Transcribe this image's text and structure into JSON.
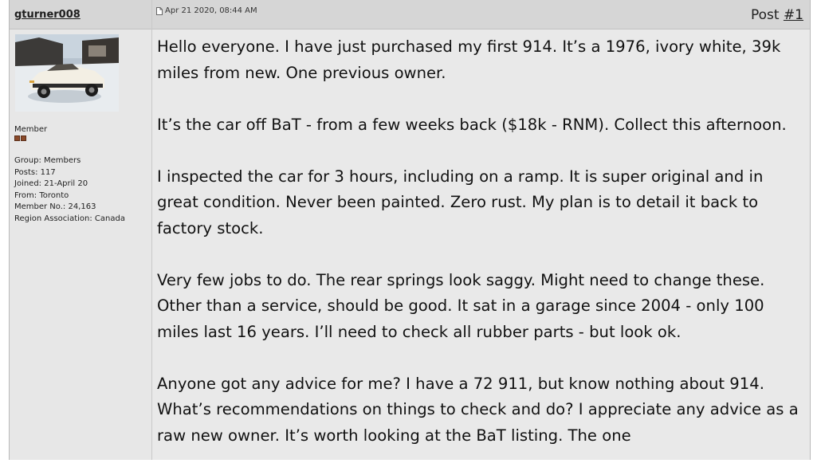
{
  "author": {
    "username": "gturner008",
    "member_title": "Member",
    "info": [
      "Group: Members",
      "Posts: 117",
      "Joined: 21-April 20",
      "From: Toronto",
      "Member No.: 24,163",
      "Region Association: Canada"
    ]
  },
  "post": {
    "date": "Apr 21 2020, 08:44 AM",
    "label": "Post",
    "number": "#1",
    "paragraphs": [
      "Hello everyone. I have just purchased my first 914. It’s a 1976, ivory white, 39k miles from new. One previous owner.",
      "It’s the car off BaT - from a few weeks back ($18k - RNM). Collect this afternoon.",
      "I inspected the car for 3 hours, including on a ramp. It is super original and in great condition. Never been painted. Zero rust. My plan is to detail it back to factory stock.",
      "Very few jobs to do. The rear springs look saggy. Might need to change these. Other than a service, should be good. It sat in a garage since 2004 - only 100 miles last 16 years. I’ll need to check all rubber parts - but look ok.",
      "Anyone got any advice for me? I have a 72 911, but know nothing about 914. What’s recommendations on things to check and do? I appreciate any advice as a raw new owner. It’s worth looking at the BaT listing. The one"
    ]
  }
}
